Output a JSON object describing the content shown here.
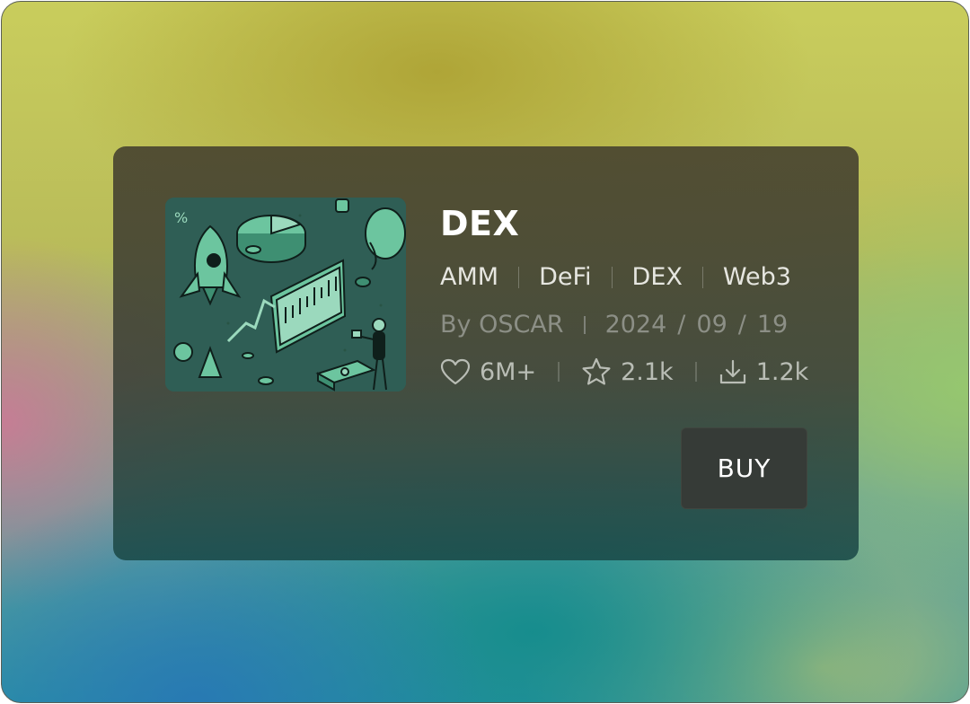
{
  "card": {
    "title": "DEX",
    "tags": [
      "AMM",
      "DeFi",
      "DEX",
      "Web3"
    ],
    "author": "By OSCAR",
    "date": {
      "year": "2024",
      "month": "09",
      "day": "19",
      "separator": "/"
    },
    "stats": {
      "likes": {
        "icon": "heart-icon",
        "value": "6M+"
      },
      "stars": {
        "icon": "star-icon",
        "value": "2.1k"
      },
      "downloads": {
        "icon": "download-icon",
        "value": "1.2k"
      }
    },
    "buy_label": "BUY",
    "thumbnail": {
      "subject": "isometric crypto trading illustration",
      "colors": {
        "background": "#2f5e55",
        "accent": "#6cc59f",
        "line": "#0f1f1b"
      }
    }
  },
  "colors": {
    "card_background": "#3f4235",
    "button_background": "#363b37",
    "title": "#ffffff",
    "muted_text": "#8c8f86"
  }
}
